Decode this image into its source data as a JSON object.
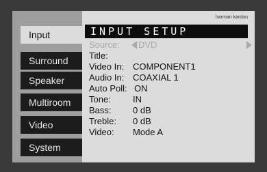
{
  "brand": "harman kardon",
  "menu": {
    "items": [
      {
        "label": "Input",
        "active": true
      },
      {
        "label": "Surround",
        "active": false
      },
      {
        "label": "Speaker",
        "active": false
      },
      {
        "label": "Multiroom",
        "active": false
      },
      {
        "label": "Video",
        "active": false
      },
      {
        "label": "System",
        "active": false
      }
    ]
  },
  "screen": {
    "title": "INPUT SETUP",
    "source": {
      "label": "Source:",
      "value": "DVD"
    },
    "rows": [
      {
        "label": "Title:",
        "value": ""
      },
      {
        "label": "Video In:",
        "value": "COMPONENT1"
      },
      {
        "label": "Audio In:",
        "value": "COAXIAL 1"
      },
      {
        "label": "Auto Poll:",
        "value": "ON"
      },
      {
        "label": "Tone:",
        "value": "IN"
      },
      {
        "label": "Bass:",
        "value": "0 dB"
      },
      {
        "label": "Treble:",
        "value": "0 dB"
      },
      {
        "label": "Video:",
        "value": "Mode A"
      }
    ]
  }
}
